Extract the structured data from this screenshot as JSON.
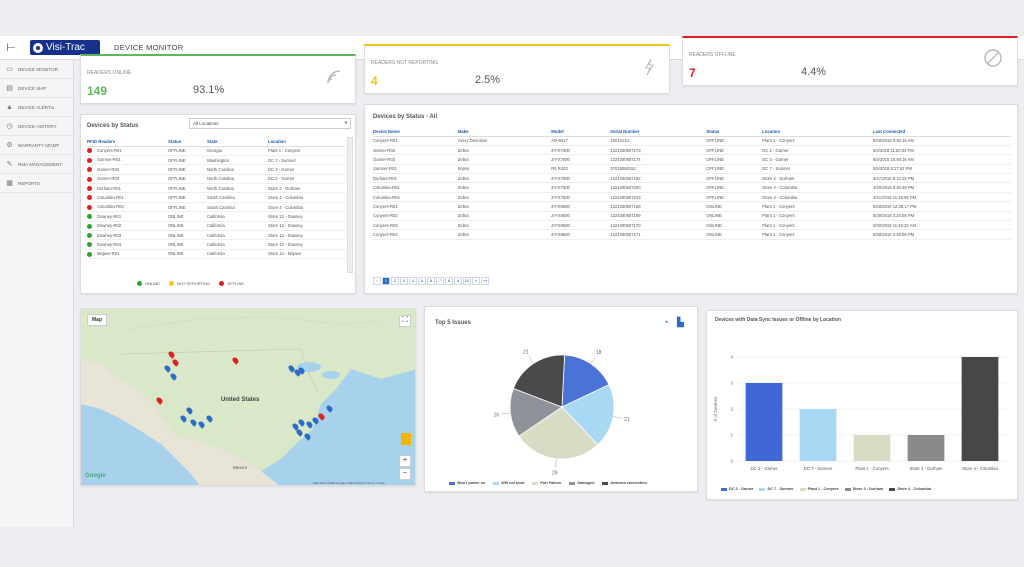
{
  "header": {
    "logo_text": "Visi-Trac",
    "page_title": "DEVICE MONITOR",
    "collapse_icon": "collapse-icon"
  },
  "sidebar": {
    "items": [
      {
        "label": "DEVICE MONITOR",
        "icon": "monitor-icon"
      },
      {
        "label": "DEVICE MAP",
        "icon": "map-icon"
      },
      {
        "label": "DEVICE ALERTS",
        "icon": "alert-icon"
      },
      {
        "label": "DEVICE HISTORY",
        "icon": "history-icon"
      },
      {
        "label": "WARRANTY MGMT",
        "icon": "gear-icon"
      },
      {
        "label": "RMA MANAGEMENT",
        "icon": "wrench-icon"
      },
      {
        "label": "REPORTS",
        "icon": "calendar-icon"
      }
    ]
  },
  "kpis": {
    "online": {
      "label": "READERS ONLINE",
      "count": "149",
      "pct": "93.1%",
      "color": "#5cb85c",
      "icon": "signal-icon"
    },
    "not_reporting": {
      "label": "READERS NOT REPORTING",
      "count": "4",
      "pct": "2.5%",
      "color": "#f0c419",
      "icon": "lightning-icon"
    },
    "offline": {
      "label": "READERS OFFLINE",
      "count": "7",
      "pct": "4.4%",
      "color": "#e02020",
      "icon": "blocked-icon"
    }
  },
  "status_panel": {
    "title": "Devices by Status",
    "filter": "All Locations",
    "columns": [
      "RFID Readers",
      "Status",
      "State",
      "Location"
    ],
    "rows": [
      {
        "c": "offline",
        "name": "Conyers-R01",
        "status": "OFFLINE",
        "state": "Georgia",
        "loc": "Plant 1 - Conyers"
      },
      {
        "c": "offline",
        "name": "Sumner-R01",
        "status": "OFFLINE",
        "state": "Washington",
        "loc": "DC 7 - Sumner"
      },
      {
        "c": "offline",
        "name": "Garner-R02",
        "status": "OFFLINE",
        "state": "North Carolina",
        "loc": "DC 2 - Garner"
      },
      {
        "c": "offline",
        "name": "Garner-R03",
        "status": "OFFLINE",
        "state": "North Carolina",
        "loc": "DC 2 - Garner"
      },
      {
        "c": "offline",
        "name": "Durham-R01",
        "status": "OFFLINE",
        "state": "North Carolina",
        "loc": "Store 2 - Durham"
      },
      {
        "c": "offline",
        "name": "Columbia-R01",
        "status": "OFFLINE",
        "state": "South Carolina",
        "loc": "Store 4 - Columbia"
      },
      {
        "c": "offline",
        "name": "Columbia-R04",
        "status": "OFFLINE",
        "state": "South Carolina",
        "loc": "Store 4 - Columbia"
      },
      {
        "c": "online",
        "name": "Downey-R01",
        "status": "ONLINE",
        "state": "California",
        "loc": "Store 13 - Downey"
      },
      {
        "c": "online",
        "name": "Downey-R02",
        "status": "ONLINE",
        "state": "California",
        "loc": "Store 13 - Downey"
      },
      {
        "c": "online",
        "name": "Downey-R03",
        "status": "ONLINE",
        "state": "California",
        "loc": "Store 13 - Downey"
      },
      {
        "c": "online",
        "name": "Downey-R04",
        "status": "ONLINE",
        "state": "California",
        "loc": "Store 13 - Downey"
      },
      {
        "c": "online",
        "name": "Mojave-R01",
        "status": "ONLINE",
        "state": "California",
        "loc": "Store 14 - Mojave"
      }
    ],
    "legend": [
      {
        "label": "ONLINE",
        "color": "#2da52d"
      },
      {
        "label": "NOT REPORTING",
        "color": "#f0c419"
      },
      {
        "label": "OFFLINE",
        "color": "#e02020"
      }
    ]
  },
  "all_panel": {
    "title": "Devices by Status - All",
    "columns": [
      "Device Name",
      "Make",
      "Model",
      "Serial Number",
      "Status",
      "Location",
      "Last Connected"
    ],
    "rows": [
      [
        "Conyers-R01",
        "Avery Dennison",
        "AD-9417",
        "15010134",
        "OFFLINE",
        "Plant 1 - Conyers",
        "5/29/2018 9:45:15 AM"
      ],
      [
        "Garner-R02",
        "Zebra",
        "Z-FX7500",
        "1224300507173",
        "OFFLINE",
        "DC 2 - Garner",
        "6/2/2018 11:50:34 PM"
      ],
      [
        "Garner-R03",
        "Zebra",
        "Z-FX7500",
        "1224300507174",
        "OFFLINE",
        "DC 2 - Garner",
        "6/4/2018 10:48:16 AM"
      ],
      [
        "Sumner-R01",
        "Impinj",
        "R5 R420",
        "37015090152",
        "OFFLINE",
        "DC 7 - Sumner",
        "5/5/2018 8:17:42 PM"
      ],
      [
        "Durham-R01",
        "Zebra",
        "Z-FX7500",
        "1224300507192",
        "OFFLINE",
        "Store 2 - Durham",
        "4/27/2018 8:12:25 PM"
      ],
      [
        "Columbia-R01",
        "Zebra",
        "Z-FX7500",
        "1224300507200",
        "OFFLINE",
        "Store 4 - Columbia",
        "4/20/2018 8:46:39 PM"
      ],
      [
        "Columbia-R04",
        "Zebra",
        "Z-FX7500",
        "1224300507203",
        "OFFLINE",
        "Store 4 - Columbia",
        "4/21/2018 11:49:05 PM"
      ],
      [
        "Conyers-R01",
        "Zebra",
        "Z-FX9500",
        "1224300507168",
        "ONLINE",
        "Plant 1 - Conyers",
        "5/29/2018 12:28:17 PM"
      ],
      [
        "Conyers-R02",
        "Zebra",
        "Z-FX9500",
        "1224300507169",
        "ONLINE",
        "Plant 1 - Conyers",
        "5/29/2018 3:24:56 PM"
      ],
      [
        "Conyers-R03",
        "Zebra",
        "Z-FX9500",
        "1224300507170",
        "ONLINE",
        "Plant 1 - Conyers",
        "5/30/2018 11:46:32 AM"
      ],
      [
        "Conyers-R04",
        "Zebra",
        "Z-FX9500",
        "1224300507171",
        "ONLINE",
        "Plant 1 - Conyers",
        "5/30/2018 2:48:06 PM"
      ]
    ],
    "pages": [
      "‹",
      "1",
      "2",
      "3",
      "4",
      "5",
      "6",
      "7",
      "8",
      "9",
      "10",
      "»",
      "»»"
    ]
  },
  "map": {
    "tag": "Map",
    "country_label": "United States",
    "city_label": "Mexico",
    "google": "Google",
    "attribution": "Map data ©2018 Google, INEGI  500 km  Terms of Use",
    "zoom_in": "+",
    "zoom_out": "−",
    "fullscreen_icon": "fullscreen-icon",
    "pegman_icon": "pegman-icon"
  },
  "pie_chart": {
    "title": "Top 5 Issues",
    "icons": [
      "pie-icon",
      "bar-chart-icon"
    ],
    "chart_data": {
      "type": "pie",
      "labels": [
        "Won't power on",
        "Will not boot",
        "Port Failure",
        "Damaged",
        "Antenna connection"
      ],
      "values": [
        18,
        21,
        29,
        16,
        21
      ],
      "colors": [
        "#4a72d8",
        "#a9d8f5",
        "#d9dcc5",
        "#8f9399",
        "#4a4a4a"
      ]
    }
  },
  "bar_chart": {
    "title": "Devices with Data Sync Issues or Offline by Location",
    "chart_data": {
      "type": "bar",
      "categories": [
        "DC 2 - Garner",
        "DC 7 - Sumner",
        "Plant 1 - Conyers",
        "Store 2 - Durham",
        "Store 4 - Columbia"
      ],
      "values": [
        3,
        2,
        1,
        1,
        4
      ],
      "colors": [
        "#3f68d4",
        "#a9d8f5",
        "#d9dcc5",
        "#8a8a8a",
        "#474747"
      ],
      "ylabel": "# of Devices",
      "ylim": [
        0,
        4
      ],
      "yticks": [
        "0",
        "1",
        "2",
        "3",
        "4"
      ]
    }
  }
}
